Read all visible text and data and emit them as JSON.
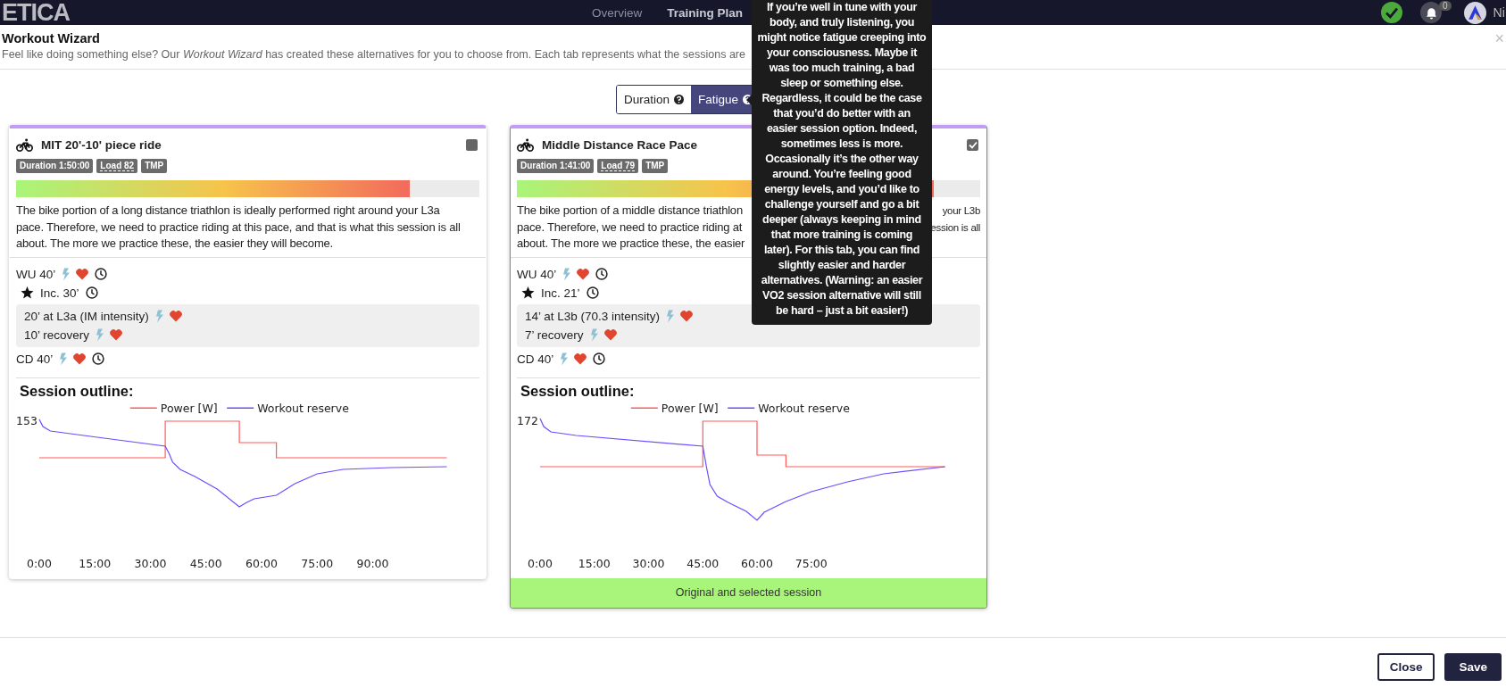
{
  "navbar": {
    "logo": "ETICA",
    "links": [
      {
        "label": "Overview",
        "selected": false
      },
      {
        "label": "Training Plan",
        "selected": true
      }
    ],
    "notification_count": "0",
    "user": "Ni"
  },
  "modal": {
    "title": "Workout Wizard",
    "subtitle": "Feel like doing something else? Our *Workout Wizard* has created these alternatives for you to choose from. Each tab represents what the sessions are",
    "close": "×"
  },
  "tabs": [
    {
      "label": "Duration",
      "selected": false
    },
    {
      "label": "Fatigue",
      "selected": true
    }
  ],
  "tooltip": "If you’re well in tune with your body, and truly listening, you might notice fatigue creeping into your consciousness. Maybe it was too much training, a bad sleep or something else. Regardless, it could be the case that you’d do better with an easier session option. Indeed, sometimes less is more. Occasionally it’s the other way around. You’re feeling good energy levels, and you’d like to challenge yourself and go a bit deeper (always keeping in mind that more training is coming later). For this tab, you can find slightly easier and harder alternatives. (Warning: an easier VO2 session alternative will still be hard – just a bit easier!)",
  "cards": [
    {
      "title": "MIT 20'-10' piece ride",
      "selected": false,
      "badges": [
        {
          "text": "Duration 1:50:00",
          "kind": "plain"
        },
        {
          "text": "Load 82",
          "kind": "hint"
        },
        {
          "text": "TMP",
          "kind": "plain"
        }
      ],
      "level": 0.85,
      "description_lines": [
        {
          "text": "The bike portion of a long distance triathlon is ideally performed right around your L3a"
        },
        {
          "text": "pace. Therefore, we need to practice riding at this pace, and that is what this session is all"
        },
        {
          "text": "about. The more we practice these, the easier they will become."
        }
      ],
      "steps": [
        {
          "kind": "step",
          "text": "WU 40’"
        },
        {
          "kind": "set",
          "text": "Inc. 30’",
          "children": [
            {
              "kind": "step",
              "text": "20’ at L3a (IM intensity)"
            },
            {
              "kind": "step",
              "text": "10’ recovery"
            }
          ]
        },
        {
          "kind": "step",
          "text": "CD 40’"
        }
      ],
      "chart": {
        "title": "Session outline:",
        "legend": [
          {
            "name": "Power [W]",
            "color": "#ff5a5a"
          },
          {
            "name": "Workout reserve",
            "color": "#6a4dff"
          }
        ],
        "y_label": "153",
        "x_labels": [
          "0:00",
          "15:00",
          "30:00",
          "45:00",
          "60:00",
          "75:00",
          "90:00"
        ]
      }
    },
    {
      "title": "Middle Distance Race Pace",
      "selected": true,
      "badges": [
        {
          "text": "Duration 1:41:00",
          "kind": "plain"
        },
        {
          "text": "Load 79",
          "kind": "hint"
        },
        {
          "text": "TMP",
          "kind": "plain"
        }
      ],
      "level": 0.9,
      "description_lines": [
        {
          "text": "The bike portion of a middle distance triathlon",
          "end": "your L3b"
        },
        {
          "text": "pace. Therefore, we need to practice riding at",
          "end": "ession is all"
        },
        {
          "text": "about. The more we practice these, the easier"
        }
      ],
      "steps": [
        {
          "kind": "step",
          "text": "WU 40’"
        },
        {
          "kind": "set",
          "text": "Inc. 21’",
          "children": [
            {
              "kind": "step",
              "text": "14’ at L3b (70.3 intensity)"
            },
            {
              "kind": "step",
              "text": "7’ recovery"
            }
          ]
        },
        {
          "kind": "step",
          "text": "CD 40’"
        }
      ],
      "chart": {
        "title": "Session outline:",
        "legend": [
          {
            "name": "Power [W]",
            "color": "#ff5a5a"
          },
          {
            "name": "Workout reserve",
            "color": "#6a4dff"
          }
        ],
        "y_label": "172",
        "x_labels": [
          "0:00",
          "15:00",
          "30:00",
          "45:00",
          "60:00",
          "75:00"
        ]
      },
      "banner": "Original and selected session"
    }
  ],
  "buttons": [
    {
      "label": "Close",
      "kind": "secondary"
    },
    {
      "label": "Save",
      "kind": "primary"
    }
  ]
}
